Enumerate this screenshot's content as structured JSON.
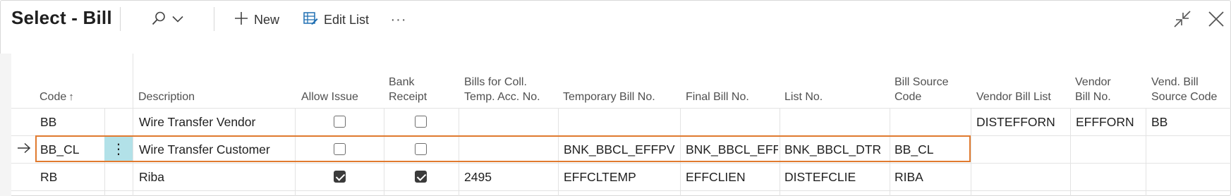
{
  "header": {
    "title": "Select - Bill",
    "new_label": "New",
    "edit_list_label": "Edit List",
    "more_label": "···"
  },
  "columns": [
    {
      "key": "code",
      "label": "Code",
      "sort": "ascending"
    },
    {
      "key": "description",
      "label": "Description"
    },
    {
      "key": "allow_issue",
      "label": "Allow Issue"
    },
    {
      "key": "bank_receipt",
      "label": "Bank\nReceipt"
    },
    {
      "key": "bills_coll",
      "label": "Bills for Coll.\nTemp. Acc. No."
    },
    {
      "key": "temp_bill_no",
      "label": "Temporary Bill No."
    },
    {
      "key": "final_bill_no",
      "label": "Final Bill No."
    },
    {
      "key": "list_no",
      "label": "List No."
    },
    {
      "key": "bill_source_code",
      "label": "Bill Source\nCode"
    },
    {
      "key": "vendor_bill_list",
      "label": "Vendor Bill List"
    },
    {
      "key": "vendor_bill_no",
      "label": "Vendor\nBill No."
    },
    {
      "key": "vend_bill_source_code",
      "label": "Vend. Bill\nSource Code"
    }
  ],
  "sort_indicator": "↑",
  "rows": [
    {
      "code": "BB",
      "description": "Wire Transfer Vendor",
      "allow_issue": false,
      "bank_receipt": false,
      "bills_coll": "",
      "temp_bill_no": "",
      "final_bill_no": "",
      "list_no": "",
      "bill_source_code": "",
      "vendor_bill_list": "DISTEFFORN",
      "vendor_bill_no": "EFFFORN",
      "vend_bill_source_code": "BB",
      "selected": false
    },
    {
      "code": "BB_CL",
      "description": "Wire Transfer Customer",
      "allow_issue": false,
      "bank_receipt": false,
      "bills_coll": "",
      "temp_bill_no": "BNK_BBCL_EFFPV",
      "final_bill_no": "BNK_BBCL_EFF",
      "list_no": "BNK_BBCL_DTR",
      "bill_source_code": "BB_CL",
      "vendor_bill_list": "",
      "vendor_bill_no": "",
      "vend_bill_source_code": "",
      "selected": true
    },
    {
      "code": "RB",
      "description": "Riba",
      "allow_issue": true,
      "bank_receipt": true,
      "bills_coll": "2495",
      "temp_bill_no": "EFFCLTEMP",
      "final_bill_no": "EFFCLIEN",
      "list_no": "DISTEFCLIE",
      "bill_source_code": "RIBA",
      "vendor_bill_list": "",
      "vendor_bill_no": "",
      "vend_bill_source_code": "",
      "selected": false
    }
  ],
  "row_actions_glyph": "⋮",
  "colors": {
    "accent": "#e07a2f",
    "row_action_bg": "#b2e1e8",
    "icon_blue": "#1f6fb2"
  },
  "icons": [
    "search-icon",
    "chevron-down-icon",
    "plus-icon",
    "edit-list-icon",
    "collapse-icon",
    "close-icon",
    "arrow-right-icon"
  ]
}
